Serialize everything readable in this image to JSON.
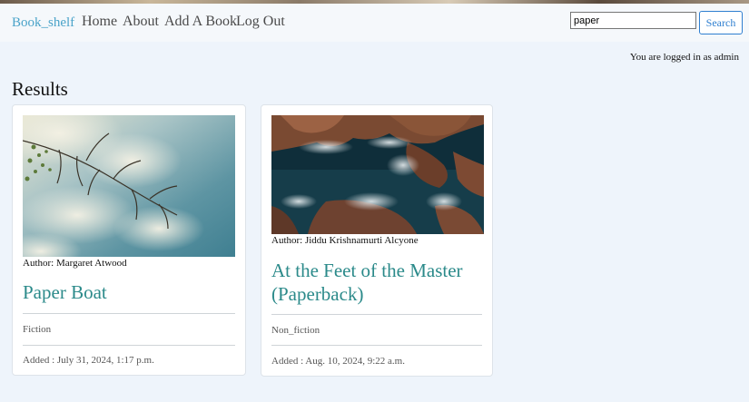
{
  "navbar": {
    "brand": "Book_shelf",
    "links": [
      "Home",
      "About",
      "Add A Book",
      "Log Out"
    ]
  },
  "search": {
    "value": "paper",
    "button_label": "Search"
  },
  "status": {
    "login_text": "You are logged in as admin"
  },
  "main": {
    "heading": "Results",
    "books": [
      {
        "author": "Author: Margaret Atwood",
        "title": "Paper Boat",
        "category": "Fiction",
        "added": "Added : July 31, 2024, 1:17 p.m."
      },
      {
        "author": "Author: Jiddu Krishnamurti Alcyone",
        "title": "At the Feet of the Master (Paperback)",
        "category": "Non_fiction",
        "added": "Added : Aug. 10, 2024, 9:22 a.m."
      }
    ]
  },
  "colors": {
    "brand": "#4aa3c9",
    "title_accent": "#2b8a8a",
    "button_accent": "#2f7fd0",
    "page_background": "#eef4fb"
  }
}
